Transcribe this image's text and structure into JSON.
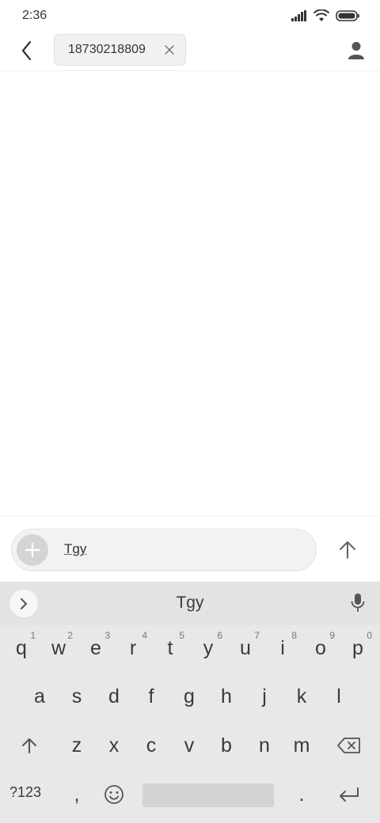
{
  "status_bar": {
    "time": "2:36"
  },
  "header": {
    "recipient": "18730218809"
  },
  "composer": {
    "text": "Tgy"
  },
  "keyboard": {
    "suggestion": "Tgy",
    "row1": [
      {
        "k": "q",
        "s": "1"
      },
      {
        "k": "w",
        "s": "2"
      },
      {
        "k": "e",
        "s": "3"
      },
      {
        "k": "r",
        "s": "4"
      },
      {
        "k": "t",
        "s": "5"
      },
      {
        "k": "y",
        "s": "6"
      },
      {
        "k": "u",
        "s": "7"
      },
      {
        "k": "i",
        "s": "8"
      },
      {
        "k": "o",
        "s": "9"
      },
      {
        "k": "p",
        "s": "0"
      }
    ],
    "row2": [
      "a",
      "s",
      "d",
      "f",
      "g",
      "h",
      "j",
      "k",
      "l"
    ],
    "row3": [
      "z",
      "x",
      "c",
      "v",
      "b",
      "n",
      "m"
    ],
    "mode_label": "?123",
    "comma": ",",
    "period": "."
  }
}
